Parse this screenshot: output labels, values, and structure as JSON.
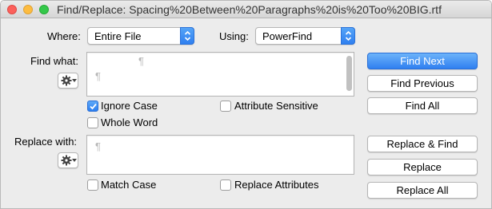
{
  "window": {
    "title": "Find/Replace: Spacing%20Between%20Paragraphs%20is%20Too%20BIG.rtf"
  },
  "where": {
    "label": "Where:",
    "value": "Entire File"
  },
  "using": {
    "label": "Using:",
    "value": "PowerFind"
  },
  "find": {
    "label": "Find what:",
    "value": "",
    "pilcrow_1": "¶",
    "pilcrow_2": "¶"
  },
  "replace": {
    "label": "Replace with:",
    "value": "",
    "pilcrow": "¶"
  },
  "options": {
    "ignore_case": {
      "label": "Ignore Case",
      "checked": true
    },
    "attribute_sensitive": {
      "label": "Attribute Sensitive",
      "checked": false
    },
    "whole_word": {
      "label": "Whole Word",
      "checked": false
    },
    "match_case": {
      "label": "Match Case",
      "checked": false
    },
    "replace_attributes": {
      "label": "Replace Attributes",
      "checked": false
    }
  },
  "buttons": {
    "find_next": "Find Next",
    "find_previous": "Find Previous",
    "find_all": "Find All",
    "replace_and_find": "Replace & Find",
    "replace": "Replace",
    "replace_all": "Replace All"
  },
  "icons": {
    "gear": "gear-icon",
    "popup_arrows": "up-down-chevron-icon",
    "checkmark": "checkmark-icon"
  },
  "colors": {
    "accent": "#2f7ff0",
    "window_bg": "#ececec"
  }
}
